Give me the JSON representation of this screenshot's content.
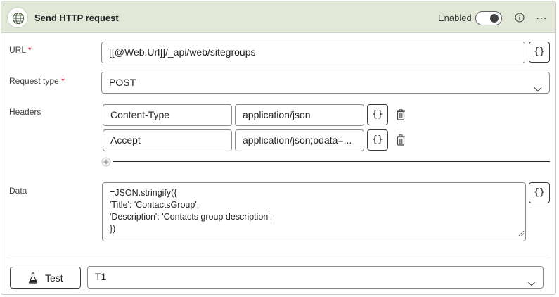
{
  "header": {
    "title": "Send HTTP request",
    "enabled_label": "Enabled",
    "enabled": true
  },
  "url": {
    "label": "URL",
    "required_mark": "*",
    "value": "[[@Web.Url]]/_api/web/sitegroups",
    "expr_button": "{}"
  },
  "request_type": {
    "label": "Request type",
    "required_mark": "*",
    "value": "POST"
  },
  "headers": {
    "label": "Headers",
    "rows": [
      {
        "name": "Content-Type",
        "value": "application/json",
        "expr_button": "{}"
      },
      {
        "name": "Accept",
        "value": "application/json;odata=...",
        "expr_button": "{}"
      }
    ]
  },
  "data": {
    "label": "Data",
    "lines": [
      "=JSON.stringify({",
      "'Title': 'ContactsGroup',",
      "'Description': 'Contacts group description',",
      "})"
    ],
    "expr_button": "{}"
  },
  "footer": {
    "test_label": "Test",
    "test_select_value": "T1"
  },
  "icons": {
    "globe": "globe-icon",
    "info": "info-icon",
    "more": "more-icon",
    "chevron": "chevron-down-icon",
    "trash": "trash-icon",
    "add": "add-icon",
    "flask": "flask-icon"
  },
  "colors": {
    "header_bg": "#e1e8d8",
    "required": "#c50f1f",
    "border": "#8a8a8a"
  }
}
